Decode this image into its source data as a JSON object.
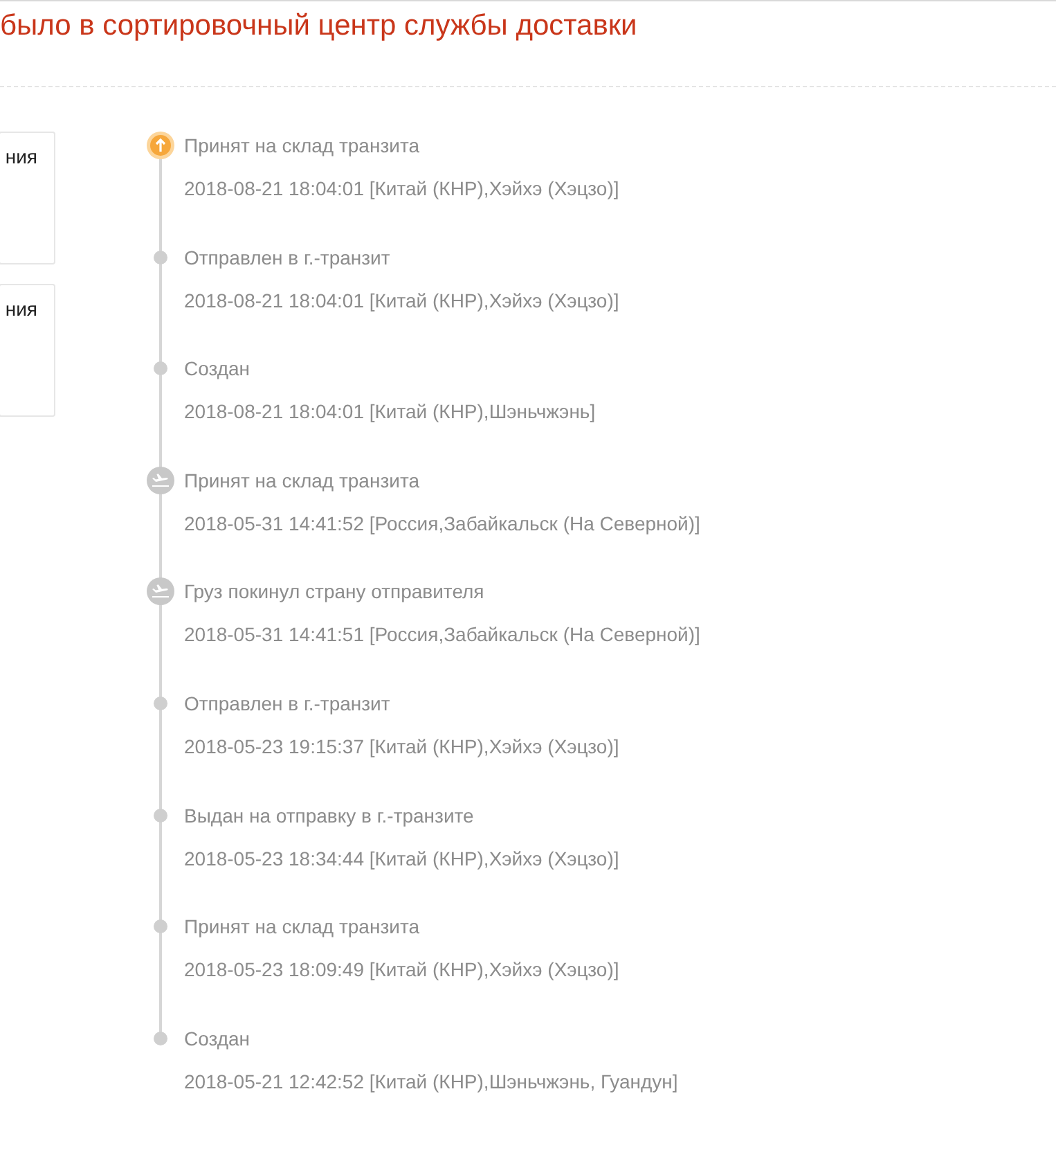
{
  "headline": "было в сортировочный центр службы доставки",
  "side_cards": [
    {
      "text": "ния"
    },
    {
      "text": "ния"
    }
  ],
  "events": [
    {
      "kind": "current",
      "status": "Принят на склад транзита",
      "detail": "2018-08-21 18:04:01 [Китай (КНР),Хэйхэ (Хэцзо)]"
    },
    {
      "kind": "dot",
      "status": "Отправлен в г.-транзит",
      "detail": "2018-08-21 18:04:01 [Китай (КНР),Хэйхэ (Хэцзо)]"
    },
    {
      "kind": "dot",
      "status": "Создан",
      "detail": "2018-08-21 18:04:01 [Китай (КНР),Шэньчжэнь]"
    },
    {
      "kind": "plane",
      "status": "Принят на склад транзита",
      "detail": "2018-05-31 14:41:52 [Россия,Забайкальск (На Северной)]"
    },
    {
      "kind": "plane",
      "status": "Груз покинул страну отправителя",
      "detail": "2018-05-31 14:41:51 [Россия,Забайкальск (На Северной)]"
    },
    {
      "kind": "dot",
      "status": "Отправлен в г.-транзит",
      "detail": "2018-05-23 19:15:37 [Китай (КНР),Хэйхэ (Хэцзо)]"
    },
    {
      "kind": "dot",
      "status": "Выдан на отправку в г.-транзите",
      "detail": "2018-05-23 18:34:44 [Китай (КНР),Хэйхэ (Хэцзо)]"
    },
    {
      "kind": "dot",
      "status": "Принят на склад транзита",
      "detail": "2018-05-23 18:09:49 [Китай (КНР),Хэйхэ (Хэцзо)]"
    },
    {
      "kind": "dot",
      "status": "Создан",
      "detail": "2018-05-21 12:42:52 [Китай (КНР),Шэньчжэнь, Гуандун]"
    }
  ]
}
